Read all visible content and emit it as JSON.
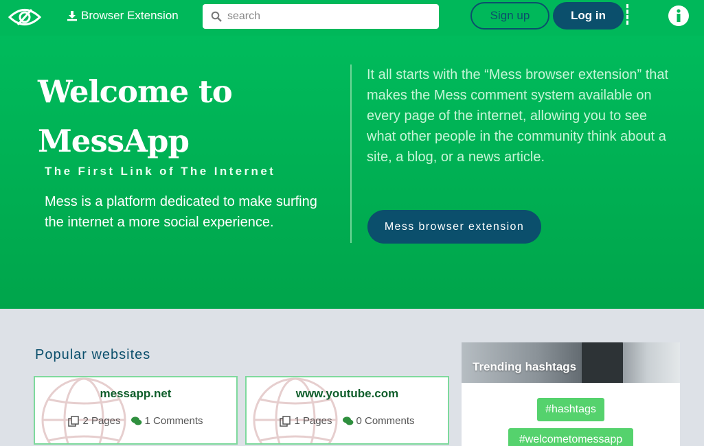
{
  "header": {
    "logo_icon": "eye-logo-icon",
    "extension_label": "Browser Extension",
    "search_placeholder": "search",
    "signup_label": "Sign up",
    "login_label": "Log in",
    "info_icon": "info-icon"
  },
  "hero": {
    "title_line1": "Welcome to",
    "title_line2": "MessApp",
    "tagline": "The First Link of The Internet",
    "description": "Mess is a platform dedicated to make surfing the internet a more social experience.",
    "extension_text": "It all starts with the “Mess browser extension” that makes the Mess comment system available on every page of the internet, allowing you to see what other people in the community think about a site, a blog, or a news article.",
    "cta_label": "Mess browser extension"
  },
  "popular": {
    "title": "Popular websites",
    "cards": [
      {
        "site": "messapp.net",
        "pages": "2 Pages",
        "comments": "1 Comments"
      },
      {
        "site": "www.youtube.com",
        "pages": "1 Pages",
        "comments": "0 Comments"
      }
    ]
  },
  "trending": {
    "title": "Trending hashtags",
    "tags": [
      "#hashtags",
      "#welcometomessapp"
    ]
  },
  "colors": {
    "header_green": "#00b85a",
    "navy": "#0b4f6c",
    "tag_green": "#55d26d",
    "card_border": "#7ed99d",
    "background": "#dde1e7"
  }
}
